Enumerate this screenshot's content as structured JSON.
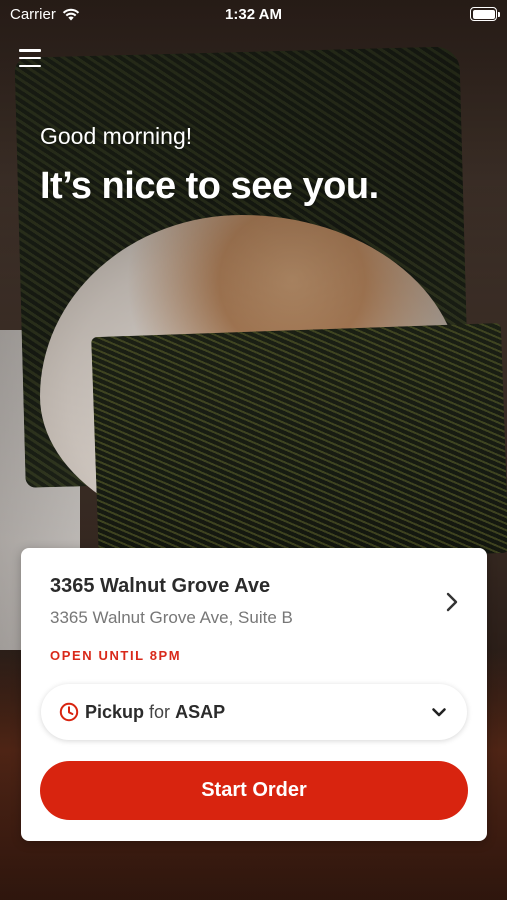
{
  "status_bar": {
    "carrier": "Carrier",
    "time": "1:32 AM"
  },
  "hero": {
    "greeting": "Good morning!",
    "headline": "It’s nice to see you."
  },
  "location": {
    "name": "3365 Walnut Grove Ave",
    "address": "3365 Walnut Grove Ave, Suite B",
    "hours": "OPEN UNTIL 8PM"
  },
  "order_mode": {
    "mode": "Pickup",
    "connector": "for",
    "time": "ASAP"
  },
  "cta": {
    "label": "Start Order"
  },
  "colors": {
    "accent": "#d8240f",
    "hours_text": "#d9291a"
  },
  "icons": {
    "menu": "hamburger-menu-icon",
    "wifi": "wifi-icon",
    "battery": "battery-icon",
    "location_chevron": "chevron-right-icon",
    "clock": "clock-icon",
    "dropdown": "chevron-down-icon"
  }
}
